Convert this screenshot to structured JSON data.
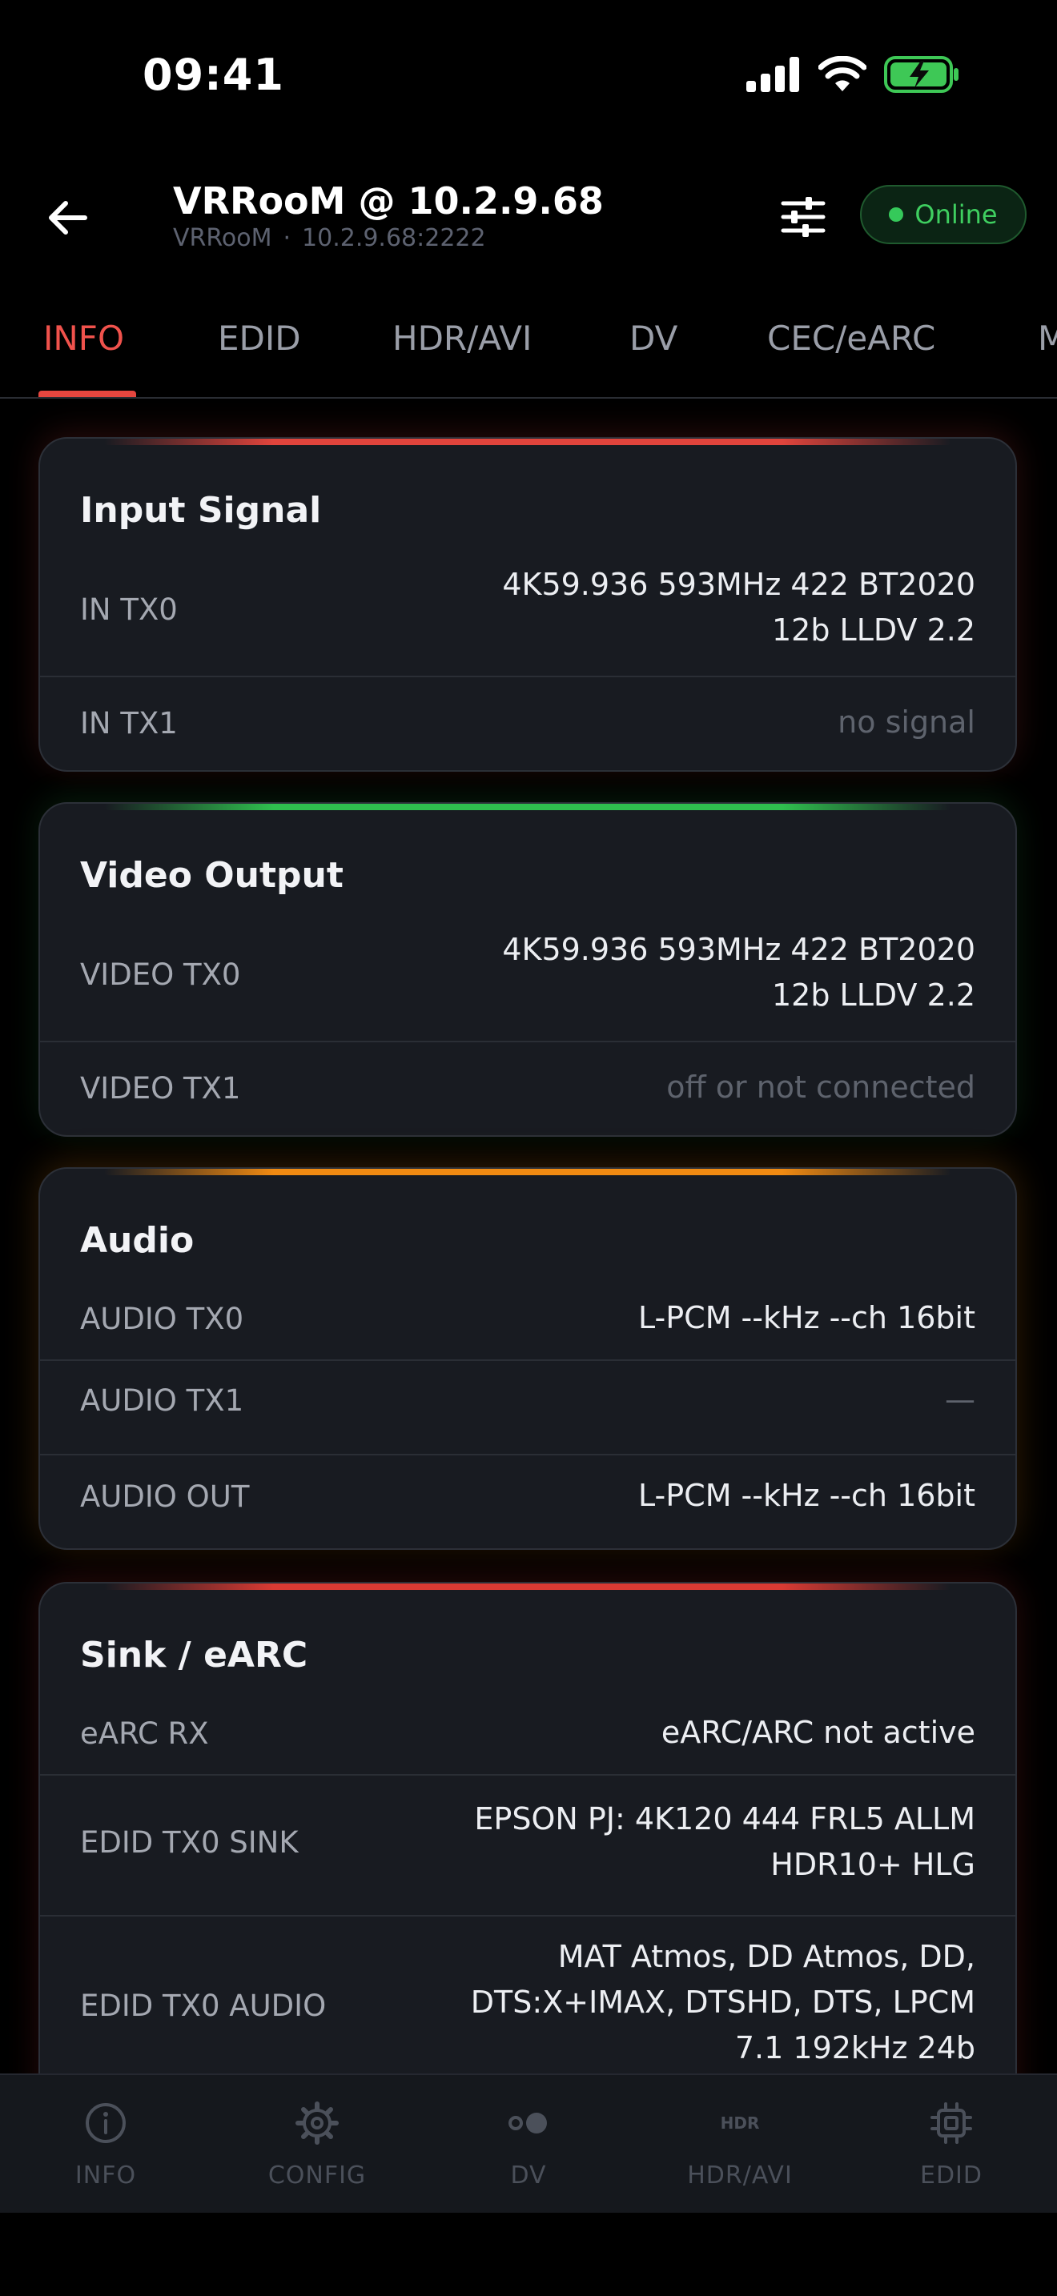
{
  "status_bar": {
    "time": "09:41"
  },
  "header": {
    "title": "VRRooM @ 10.2.9.68",
    "subtitle_name": "VRRooM",
    "subtitle_sep": "·",
    "subtitle_address": "10.2.9.68:2222",
    "status": "Online",
    "status_color": "#3fcf60"
  },
  "tabs": [
    {
      "label": "INFO",
      "active": true
    },
    {
      "label": "EDID"
    },
    {
      "label": "HDR/AVI"
    },
    {
      "label": "DV"
    },
    {
      "label": "CEC/eARC"
    },
    {
      "label": "M"
    }
  ],
  "cards": {
    "input_signal": {
      "title": "Input Signal",
      "accent": "#e0443c",
      "rows": [
        {
          "label": "IN TX0",
          "value_line1": "4K59.936 593MHz 422 BT2020",
          "value_line2": "12b LLDV  2.2"
        },
        {
          "label": "IN TX1",
          "value": "no signal"
        }
      ]
    },
    "video_output": {
      "title": "Video Output",
      "accent": "#2fbf4e",
      "rows": [
        {
          "label": "VIDEO TX0",
          "value_line1": "4K59.936 593MHz 422 BT2020",
          "value_line2": "12b LLDV  2.2"
        },
        {
          "label": "VIDEO TX1",
          "value": "off or not connected"
        }
      ]
    },
    "audio": {
      "title": "Audio",
      "accent": "#f08a12",
      "rows": [
        {
          "label": "AUDIO TX0",
          "value": "L-PCM --kHz --ch 16bit"
        },
        {
          "label": "AUDIO TX1",
          "value": "—"
        },
        {
          "label": "AUDIO OUT",
          "value": "L-PCM --kHz --ch 16bit"
        }
      ]
    },
    "sink_earc": {
      "title": "Sink / eARC",
      "accent": "#d93a33",
      "rows": [
        {
          "label": "eARC RX",
          "value": "eARC/ARC not active"
        },
        {
          "label": "EDID TX0 SINK",
          "value_line1": "EPSON PJ: 4K120 444 FRL5 ALLM",
          "value_line2": "HDR10+ HLG"
        },
        {
          "label": "EDID TX0 AUDIO",
          "value_line1": "MAT Atmos, DD Atmos, DD,",
          "value_line2": "DTS:X+IMAX, DTSHD, DTS, LPCM",
          "value_line3": "7.1  192kHz  24b"
        }
      ]
    }
  },
  "bottom_nav": [
    {
      "label": "INFO",
      "icon": "info-icon"
    },
    {
      "label": "CONFIG",
      "icon": "gear-icon"
    },
    {
      "label": "DV",
      "icon": "toggle-icon"
    },
    {
      "label": "HDR/AVI",
      "icon": "hdr-icon",
      "icon_text": "HDR"
    },
    {
      "label": "EDID",
      "icon": "chip-icon"
    }
  ]
}
